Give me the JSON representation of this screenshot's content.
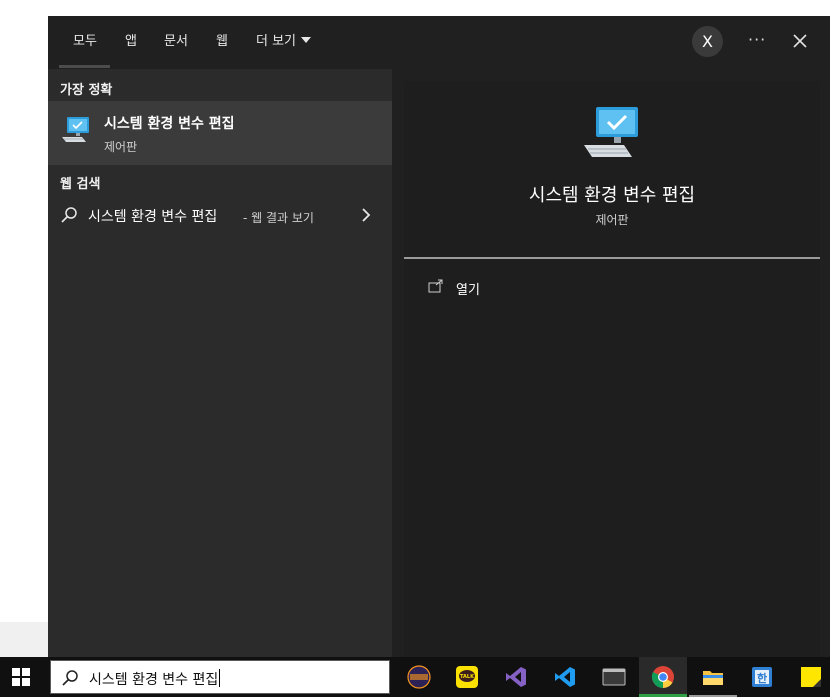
{
  "tabs": [
    {
      "label": "모두"
    },
    {
      "label": "앱"
    },
    {
      "label": "문서"
    },
    {
      "label": "웹"
    },
    {
      "label": "더 보기"
    }
  ],
  "account_initial": "X",
  "more_label": "···",
  "left": {
    "best_match_header": "가장 정확",
    "best_match": {
      "title": "시스템 환경 변수 편집",
      "subtitle": "제어판"
    },
    "web_header": "웹 검색",
    "web_query": "시스템 환경 변수 편집",
    "web_suffix": "- 웹 결과 보기"
  },
  "right": {
    "title": "시스템 환경 변수 편집",
    "subtitle": "제어판",
    "action_open": "열기"
  },
  "taskbar": {
    "search_value": "시스템 환경 변수 편집",
    "apps": [
      "eclipse-icon",
      "kakaotalk-icon",
      "visual-studio-icon",
      "vscode-icon",
      "terminal-icon",
      "chrome-icon",
      "file-explorer-icon",
      "hangul-icon",
      "sticky-notes-icon"
    ],
    "kakao_label": "TALK",
    "hangul_label": "한"
  },
  "colors": {
    "accent": "#2d9cdb",
    "panel": "#2b2b2b",
    "selected": "#3b3b3b"
  }
}
